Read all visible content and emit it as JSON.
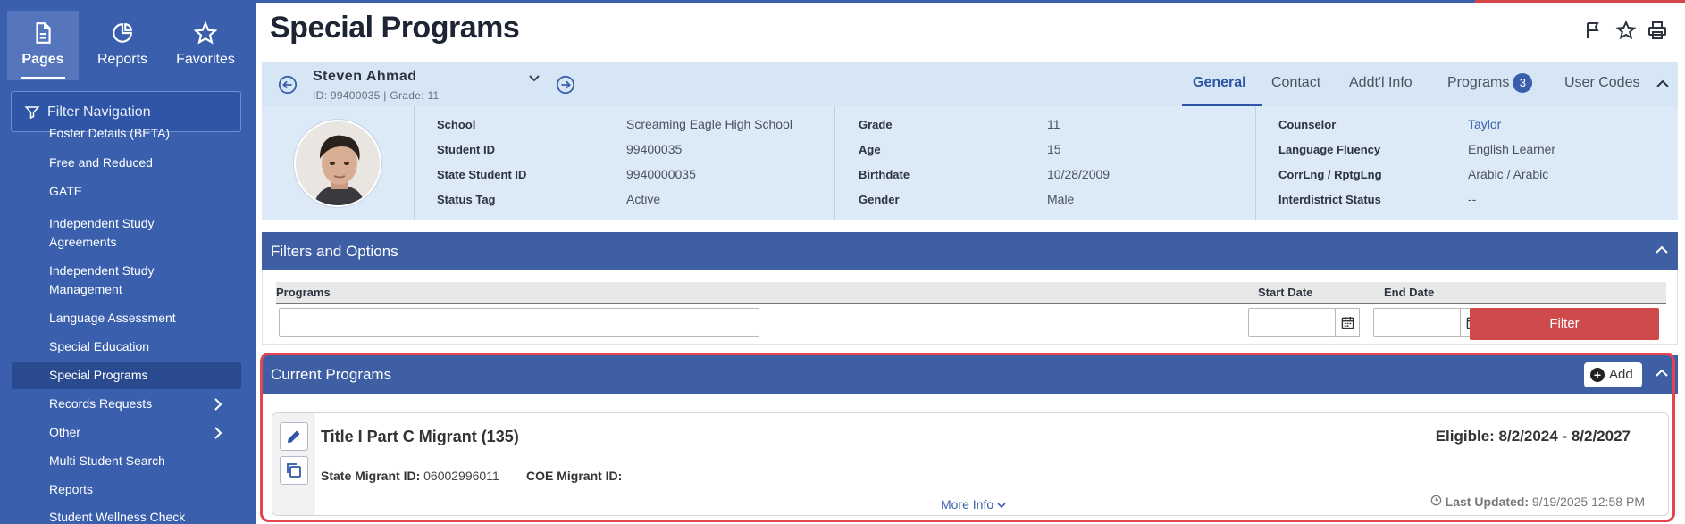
{
  "sidebar": {
    "tabs": [
      {
        "label": "Pages",
        "icon": "document-icon",
        "active": true
      },
      {
        "label": "Reports",
        "icon": "pie-chart-icon",
        "active": false
      },
      {
        "label": "Favorites",
        "icon": "star-icon",
        "active": false
      }
    ],
    "filter_placeholder": "Filter Navigation",
    "items": [
      {
        "label": "Foster Details (BETA)"
      },
      {
        "label": "Free and Reduced"
      },
      {
        "label": "GATE"
      },
      {
        "label": "Independent Study Agreements"
      },
      {
        "label": "Independent Study Management"
      },
      {
        "label": "Language Assessment"
      },
      {
        "label": "Special Education"
      },
      {
        "label": "Special Programs",
        "active": true
      },
      {
        "label": "Records Requests",
        "has_submenu": true
      },
      {
        "label": "Other",
        "has_submenu": true
      },
      {
        "label": "Multi Student Search"
      },
      {
        "label": "Reports"
      },
      {
        "label": "Student Wellness Check"
      }
    ]
  },
  "page": {
    "title": "Special Programs"
  },
  "student": {
    "name": "Steven Ahmad",
    "sub": "ID: 99400035 |  Grade: 11",
    "tabs": {
      "general": "General",
      "contact": "Contact",
      "addl": "Addt'l Info",
      "programs": "Programs",
      "programs_count": "3",
      "user_codes": "User Codes"
    },
    "fields": {
      "school_label": "School",
      "school": "Screaming Eagle High School",
      "student_id_label": "Student ID",
      "student_id": "99400035",
      "state_id_label": "State Student ID",
      "state_id": "9940000035",
      "status_label": "Status Tag",
      "status": "Active",
      "grade_label": "Grade",
      "grade": "11",
      "age_label": "Age",
      "age": "15",
      "birthdate_label": "Birthdate",
      "birthdate": "10/28/2009",
      "gender_label": "Gender",
      "gender": "Male",
      "counselor_label": "Counselor",
      "counselor": "Taylor",
      "fluency_label": "Language Fluency",
      "fluency": "English Learner",
      "corrlng_label": "CorrLng / RptgLng",
      "corrlng": "Arabic / Arabic",
      "interdistrict_label": "Interdistrict Status",
      "interdistrict": "--"
    }
  },
  "filters": {
    "title": "Filters and Options",
    "programs_label": "Programs",
    "start_label": "Start Date",
    "end_label": "End Date",
    "programs_value": "",
    "start_value": "",
    "end_value": "",
    "button": "Filter"
  },
  "current": {
    "title": "Current Programs",
    "add_label": "Add",
    "program": {
      "name": "Title I Part C Migrant (135)",
      "eligible": "Eligible: 8/2/2024 - 8/2/2027",
      "state_migrant_label": "State Migrant ID:",
      "state_migrant_value": "06002996011",
      "coe_label": "COE Migrant ID:",
      "coe_value": "",
      "more_info": "More Info",
      "last_updated_label": "Last Updated:",
      "last_updated_value": "9/19/2025 12:58 PM"
    }
  },
  "colors": {
    "sidebar": "#3a60ad",
    "panel_header": "#3f5fa4",
    "accent": "#2f56a6",
    "filter_button": "#cf4a4a",
    "highlight": "#e3454f"
  }
}
